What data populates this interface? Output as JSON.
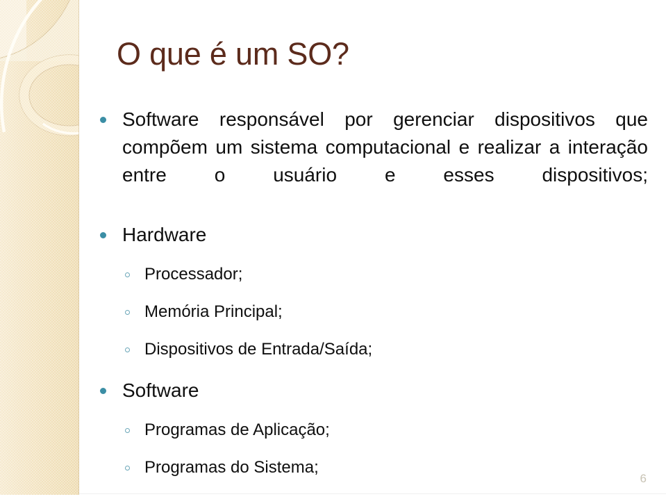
{
  "slide": {
    "title": "O que é um SO?",
    "page_number": "6",
    "colors": {
      "title": "#5c2b1c",
      "bullet_level1": "#3b8ea5",
      "bullet_level2": "#6aa6b8",
      "body_text": "#0f0f0f",
      "sidebar_background": "#f3e4c3",
      "page_number": "#c8c3b4",
      "slide_background": "#ffffff"
    },
    "content": [
      {
        "level": 1,
        "bullet": "filled-circle-bullet",
        "justified": true,
        "text": "Software responsável por gerenciar dispositivos que compõem um sistema computacional e realizar a interação entre o usuário e esses dispositivos;"
      },
      {
        "level": 1,
        "bullet": "filled-circle-bullet",
        "justified": false,
        "text": "Hardware"
      },
      {
        "level": 2,
        "bullet": "hollow-circle-bullet",
        "text": "Processador;"
      },
      {
        "level": 2,
        "bullet": "hollow-circle-bullet",
        "text": "Memória Principal;"
      },
      {
        "level": 2,
        "bullet": "hollow-circle-bullet",
        "text": "Dispositivos de Entrada/Saída;"
      },
      {
        "level": 1,
        "bullet": "filled-circle-bullet",
        "justified": false,
        "text": "Software"
      },
      {
        "level": 2,
        "bullet": "hollow-circle-bullet",
        "text": "Programas de Aplicação;"
      },
      {
        "level": 2,
        "bullet": "hollow-circle-bullet",
        "text": "Programas do Sistema;"
      }
    ]
  }
}
